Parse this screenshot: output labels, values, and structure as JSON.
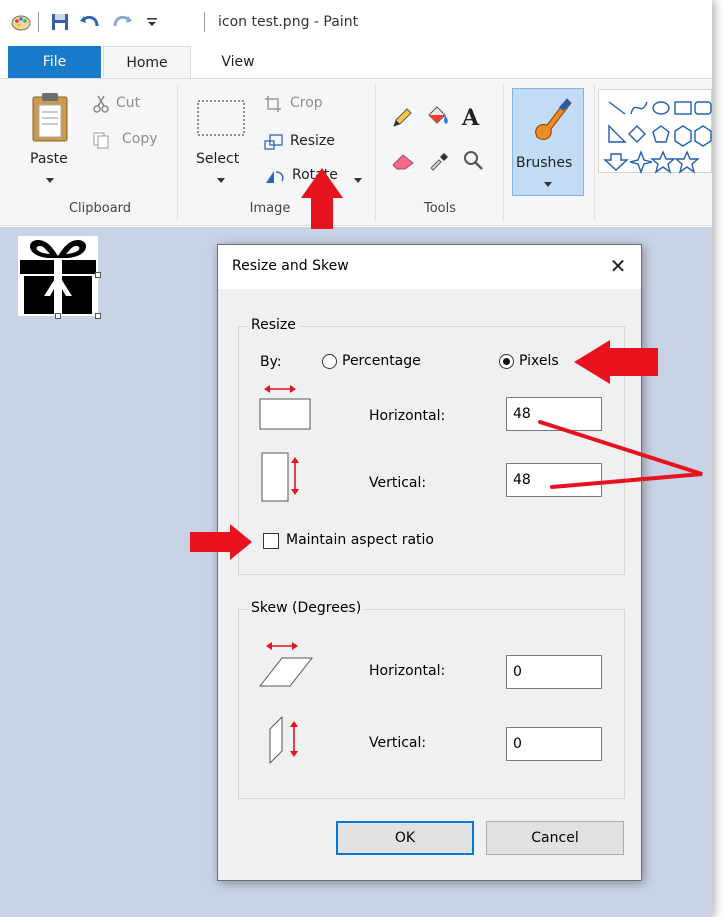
{
  "window": {
    "title": "icon test.png - Paint"
  },
  "tabs": {
    "file": "File",
    "home": "Home",
    "view": "View"
  },
  "ribbon": {
    "clipboard": {
      "paste": "Paste",
      "cut": "Cut",
      "copy": "Copy",
      "group_label": "Clipboard"
    },
    "image": {
      "select": "Select",
      "crop": "Crop",
      "resize": "Resize",
      "rotate": "Rotate",
      "group_label": "Image"
    },
    "tools": {
      "group_label": "Tools",
      "text_tool": "A"
    },
    "brushes": {
      "label": "Brushes"
    }
  },
  "dialog": {
    "title": "Resize and Skew",
    "resize": {
      "legend": "Resize",
      "by_label": "By:",
      "percentage_label": "Percentage",
      "pixels_label": "Pixels",
      "selected_unit": "Pixels",
      "horizontal_label": "Horizontal:",
      "horizontal_value": "48",
      "vertical_label": "Vertical:",
      "vertical_value": "48",
      "maintain_aspect_label": "Maintain aspect ratio",
      "maintain_aspect_checked": false
    },
    "skew": {
      "legend": "Skew (Degrees)",
      "horizontal_label": "Horizontal:",
      "horizontal_value": "0",
      "vertical_label": "Vertical:",
      "vertical_value": "0"
    },
    "ok_label": "OK",
    "cancel_label": "Cancel"
  },
  "colors": {
    "accent": "#1979ca",
    "annotation_red": "#e8121f",
    "workspace": "#c9d3e6",
    "ribbon_bg": "#f5f6f7"
  }
}
